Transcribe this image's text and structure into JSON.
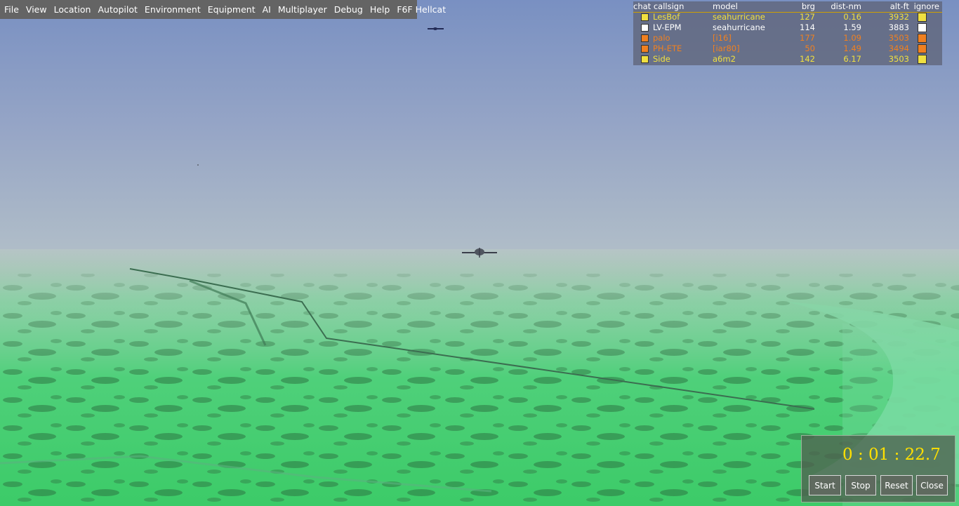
{
  "menu": [
    "File",
    "View",
    "Location",
    "Autopilot",
    "Environment",
    "Equipment",
    "AI",
    "Multiplayer",
    "Debug",
    "Help",
    "F6F Hellcat"
  ],
  "mp_list": {
    "headers": {
      "chat": "chat",
      "callsign": "callsign",
      "model": "model",
      "brg": "brg",
      "dist": "dist-nm",
      "alt": "alt-ft",
      "ignore": "ignore"
    },
    "rows": [
      {
        "callsign": "LesBof",
        "model": "seahurricane",
        "brg": "127",
        "dist": "0.16",
        "alt": "3932",
        "color": "#f0e040"
      },
      {
        "callsign": "LV-EPM",
        "model": "seahurricane",
        "brg": "114",
        "dist": "1.59",
        "alt": "3883",
        "color": "#ffffff"
      },
      {
        "callsign": "palo",
        "model": "[i16]",
        "brg": "177",
        "dist": "1.09",
        "alt": "3503",
        "color": "#f08020"
      },
      {
        "callsign": "PH-ETE",
        "model": "[iar80]",
        "brg": "50",
        "dist": "1.49",
        "alt": "3494",
        "color": "#f08020"
      },
      {
        "callsign": "Side",
        "model": "a6m2",
        "brg": "142",
        "dist": "6.17",
        "alt": "3503",
        "color": "#f0e040"
      }
    ]
  },
  "stopwatch": {
    "time": "0 : 01 : 22.7",
    "start": "Start",
    "stop": "Stop",
    "reset": "Reset",
    "close": "Close"
  }
}
